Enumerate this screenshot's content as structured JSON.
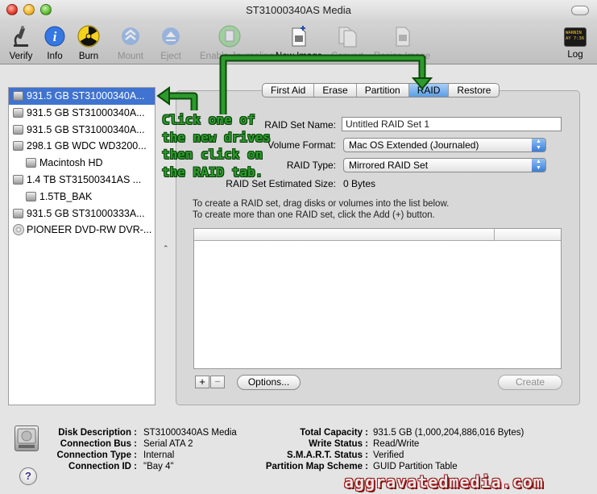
{
  "window": {
    "title": "ST31000340AS Media"
  },
  "toolbar": {
    "items": [
      {
        "label": "Verify",
        "icon": "microscope-icon",
        "enabled": true
      },
      {
        "label": "Info",
        "icon": "info-icon",
        "enabled": true
      },
      {
        "label": "Burn",
        "icon": "burn-icon",
        "enabled": true
      },
      {
        "label": "Mount",
        "icon": "mount-icon",
        "enabled": false
      },
      {
        "label": "Eject",
        "icon": "eject-icon",
        "enabled": false
      },
      {
        "label": "Enable Journaling",
        "icon": "journaling-icon",
        "enabled": false
      },
      {
        "label": "New Image",
        "icon": "new-image-icon",
        "enabled": true
      },
      {
        "label": "Convert",
        "icon": "convert-icon",
        "enabled": false
      },
      {
        "label": "Resize Image",
        "icon": "resize-image-icon",
        "enabled": false
      }
    ],
    "log_label": "Log",
    "log_icon_text": "WARNIN\nAY 7:36"
  },
  "sidebar": {
    "items": [
      {
        "label": "931.5 GB ST31000340A...",
        "type": "disk",
        "indent": false,
        "selected": true
      },
      {
        "label": "931.5 GB ST31000340A...",
        "type": "disk",
        "indent": false,
        "selected": false
      },
      {
        "label": "931.5 GB ST31000340A...",
        "type": "disk",
        "indent": false,
        "selected": false
      },
      {
        "label": "298.1 GB WDC WD3200...",
        "type": "disk",
        "indent": false,
        "selected": false
      },
      {
        "label": "Macintosh HD",
        "type": "volume",
        "indent": true,
        "selected": false
      },
      {
        "label": "1.4 TB ST31500341AS ...",
        "type": "disk",
        "indent": false,
        "selected": false
      },
      {
        "label": "1.5TB_BAK",
        "type": "volume",
        "indent": true,
        "selected": false
      },
      {
        "label": "931.5 GB ST31000333A...",
        "type": "disk",
        "indent": false,
        "selected": false
      },
      {
        "label": "PIONEER DVD-RW DVR-...",
        "type": "optical",
        "indent": false,
        "selected": false
      }
    ]
  },
  "tabs": [
    {
      "label": "First Aid",
      "active": false
    },
    {
      "label": "Erase",
      "active": false
    },
    {
      "label": "Partition",
      "active": false
    },
    {
      "label": "RAID",
      "active": true
    },
    {
      "label": "Restore",
      "active": false
    }
  ],
  "raid": {
    "set_name_label": "RAID Set Name:",
    "set_name_value": "Untitled RAID Set 1",
    "volume_format_label": "Volume Format:",
    "volume_format_value": "Mac OS Extended (Journaled)",
    "raid_type_label": "RAID Type:",
    "raid_type_value": "Mirrored RAID Set",
    "estimated_size_label": "RAID Set Estimated Size:",
    "estimated_size_value": "0 Bytes",
    "instructions_1": "To create a RAID set, drag disks or volumes into the list below.",
    "instructions_2": "To create more than one RAID set, click the Add (+) button.",
    "add_label": "+",
    "remove_label": "−",
    "options_label": "Options...",
    "create_label": "Create"
  },
  "info": {
    "disk_description_label": "Disk Description :",
    "disk_description_value": "ST31000340AS Media",
    "connection_bus_label": "Connection Bus :",
    "connection_bus_value": "Serial ATA 2",
    "connection_type_label": "Connection Type :",
    "connection_type_value": "Internal",
    "connection_id_label": "Connection ID :",
    "connection_id_value": "\"Bay 4\"",
    "total_capacity_label": "Total Capacity :",
    "total_capacity_value": "931.5 GB (1,000,204,886,016 Bytes)",
    "write_status_label": "Write Status :",
    "write_status_value": "Read/Write",
    "smart_status_label": "S.M.A.R.T. Status :",
    "smart_status_value": "Verified",
    "partition_map_label": "Partition Map Scheme :",
    "partition_map_value": "GUID Partition Table",
    "help_label": "?"
  },
  "annotation": {
    "text": "Click one of\nthe new drives\nthen click on\nthe RAID tab."
  },
  "watermark": {
    "text": "aggravatedmedia.com"
  },
  "colors": {
    "selection": "#3f73cf",
    "annotation_green": "#2d9a2d",
    "tab_active": "#5b9de8"
  }
}
